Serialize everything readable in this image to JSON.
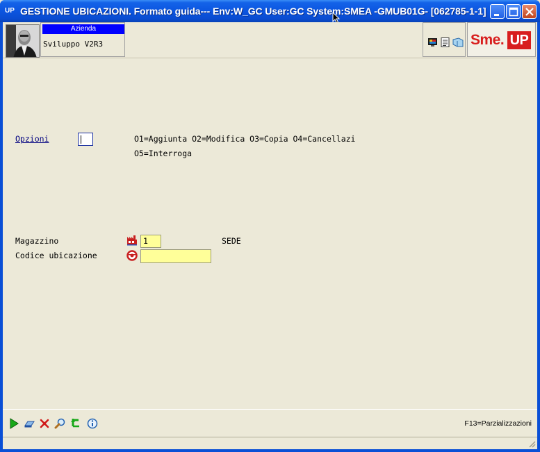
{
  "window": {
    "app_icon_label": "UP",
    "title": "GESTIONE UBICAZIONI.  Formato guida--- Env:W_GC User:GC System:SMEA -GMUB01G- [062785-1-1]"
  },
  "header": {
    "azienda_label": "Azienda",
    "azienda_value": "Sviluppo V2R3",
    "logo_sme": "Sme.",
    "logo_up": "UP"
  },
  "form": {
    "opzioni_label": "Opzioni",
    "opzioni_value": "",
    "options_line1": "O1=Aggiunta O2=Modifica O3=Copia O4=Cancellazi",
    "options_line2": "O5=Interroga",
    "magazzino_label": "Magazzino",
    "magazzino_value": "1",
    "magazzino_desc": "SEDE",
    "codice_label": "Codice ubicazione",
    "codice_value": ""
  },
  "footer": {
    "function_key_hint": "F13=Parzializzazioni",
    "icons": [
      "play-icon",
      "eraser-icon",
      "cancel-icon",
      "search-icon",
      "back-icon",
      "info-icon"
    ]
  }
}
